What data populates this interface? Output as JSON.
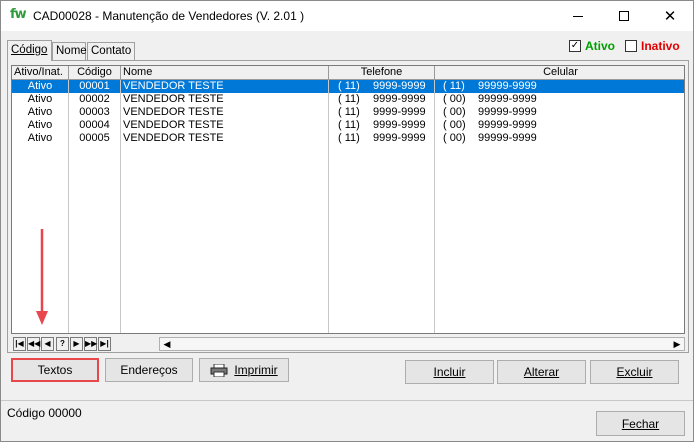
{
  "window": {
    "logo": "fw",
    "title": "CAD00028 - Manutenção de Vendedores  (V.  2.01 )"
  },
  "tabs": [
    {
      "label": "Código",
      "active": true
    },
    {
      "label": "Nome",
      "active": false
    },
    {
      "label": "Contato",
      "active": false
    }
  ],
  "filters": {
    "ativo": {
      "label": "Ativo",
      "checked": true,
      "color": "#00a000"
    },
    "inativo": {
      "label": "Inativo",
      "checked": false,
      "color": "#e00000"
    }
  },
  "grid": {
    "columns": [
      "Ativo/Inat.",
      "Código",
      "Nome",
      "Telefone",
      "Celular"
    ],
    "rows": [
      {
        "status": "Ativo",
        "codigo": "00001",
        "nome": "VENDEDOR TESTE",
        "tel_ddd": "( 11)",
        "tel": "9999-9999",
        "cel_ddd": "( 11)",
        "cel": "99999-9999",
        "selected": true
      },
      {
        "status": "Ativo",
        "codigo": "00002",
        "nome": "VENDEDOR TESTE",
        "tel_ddd": "( 11)",
        "tel": "9999-9999",
        "cel_ddd": "( 00)",
        "cel": "99999-9999",
        "selected": false
      },
      {
        "status": "Ativo",
        "codigo": "00003",
        "nome": "VENDEDOR TESTE",
        "tel_ddd": "( 11)",
        "tel": "9999-9999",
        "cel_ddd": "( 00)",
        "cel": "99999-9999",
        "selected": false
      },
      {
        "status": "Ativo",
        "codigo": "00004",
        "nome": "VENDEDOR TESTE",
        "tel_ddd": "( 11)",
        "tel": "9999-9999",
        "cel_ddd": "( 00)",
        "cel": "99999-9999",
        "selected": false
      },
      {
        "status": "Ativo",
        "codigo": "00005",
        "nome": "VENDEDOR TESTE",
        "tel_ddd": "( 11)",
        "tel": "9999-9999",
        "cel_ddd": "( 00)",
        "cel": "99999-9999",
        "selected": false
      }
    ],
    "selection_color": "#0078d7"
  },
  "navigator": {
    "buttons": [
      "|◀",
      "◀◀",
      "◀",
      "?",
      "▶",
      "▶▶",
      "▶|"
    ]
  },
  "actions": {
    "textos": "Textos",
    "enderecos": "Endereços",
    "imprimir": "Imprimir",
    "incluir": "Incluir",
    "alterar": "Alterar",
    "excluir": "Excluir",
    "fechar": "Fechar"
  },
  "highlight_color": "#e8474b",
  "status_bar": {
    "codigo": "Código  00000"
  },
  "icons": [
    "fw-logo-icon",
    "minimize-icon",
    "maximize-icon",
    "close-icon",
    "printer-icon",
    "arrow-down-icon"
  ]
}
